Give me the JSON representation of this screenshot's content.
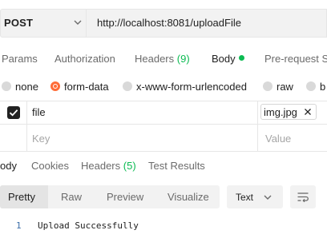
{
  "request": {
    "method": "POST",
    "url": "http://localhost:8081/uploadFile"
  },
  "request_tabs": [
    {
      "label": "Params"
    },
    {
      "label": "Authorization"
    },
    {
      "label": "Headers",
      "count": "(9)"
    },
    {
      "label": "Body",
      "active": true
    },
    {
      "label": "Pre-request S"
    }
  ],
  "body_types": [
    {
      "label": "none"
    },
    {
      "label": "form-data",
      "selected": true
    },
    {
      "label": "x-www-form-urlencoded"
    },
    {
      "label": "raw"
    },
    {
      "label": "b"
    }
  ],
  "form_rows": [
    {
      "key": "file",
      "value": "img.jpg",
      "checked": true
    },
    {
      "key_placeholder": "Key",
      "value_placeholder": "Value"
    }
  ],
  "response_tabs": [
    {
      "label": "ody",
      "active": true
    },
    {
      "label": "Cookies"
    },
    {
      "label": "Headers",
      "count": "(5)"
    },
    {
      "label": "Test Results"
    }
  ],
  "view_modes": [
    "Pretty",
    "Raw",
    "Preview",
    "Visualize"
  ],
  "format": "Text",
  "response_lines": [
    {
      "num": "1",
      "text": "Upload Successfully"
    }
  ],
  "colors": {
    "accent": "#ff6c37",
    "success": "#0cbb52"
  },
  "icons": [
    "chevron-down-icon",
    "checkbox-checked-icon",
    "close-icon",
    "wrap-lines-icon"
  ]
}
